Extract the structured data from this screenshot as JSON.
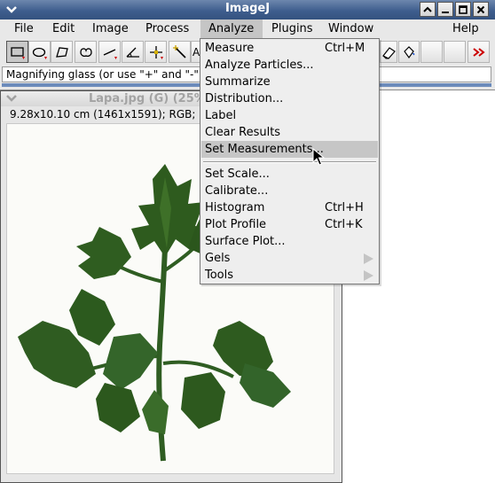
{
  "app": {
    "title": "ImageJ"
  },
  "window_buttons": [
    {
      "name": "window-menu-button",
      "glyph": "chevron-down-icon"
    },
    {
      "name": "collapse-button",
      "glyph": "chevron-up-icon"
    },
    {
      "name": "minimize-button",
      "glyph": "minimize-icon"
    },
    {
      "name": "maximize-button",
      "glyph": "maximize-icon"
    },
    {
      "name": "close-button",
      "glyph": "close-icon"
    }
  ],
  "menubar": {
    "items": [
      {
        "label": "File"
      },
      {
        "label": "Edit"
      },
      {
        "label": "Image"
      },
      {
        "label": "Process"
      },
      {
        "label": "Analyze",
        "active": true
      },
      {
        "label": "Plugins"
      },
      {
        "label": "Window"
      },
      {
        "label": "Help"
      }
    ]
  },
  "toolbar": {
    "tools": [
      "rectangle-selection-icon",
      "oval-selection-icon",
      "polygon-selection-icon",
      "freehand-selection-icon",
      "line-selection-icon",
      "angle-tool-icon",
      "point-tool-icon",
      "wand-tool-icon",
      "text-tool-icon",
      "magnifying-glass-icon",
      "scroll-tool-icon",
      "color-picker-icon",
      "dropper-icon",
      "eraser-icon",
      "paint-bucket-icon",
      "blank-tool-icon",
      "blank-tool-icon",
      "more-tools-icon"
    ],
    "selected_index": 0
  },
  "status": {
    "text": "Magnifying glass (or use \"+\" and \"-\""
  },
  "image_window": {
    "title": "Lapa.jpg (G) (25%)",
    "info": "9.28x10.10 cm (1461x1591); RGB;"
  },
  "analyze_menu": {
    "items": [
      {
        "label": "Measure",
        "accel": "Ctrl+M"
      },
      {
        "label": "Analyze Particles...",
        "accel": ""
      },
      {
        "label": "Summarize",
        "accel": ""
      },
      {
        "label": "Distribution...",
        "accel": ""
      },
      {
        "label": "Label",
        "accel": ""
      },
      {
        "label": "Clear Results",
        "accel": ""
      },
      {
        "label": "Set Measurements...",
        "accel": "",
        "hover": true
      },
      {
        "separator": true
      },
      {
        "label": "Set Scale...",
        "accel": ""
      },
      {
        "label": "Calibrate...",
        "accel": ""
      },
      {
        "label": "Histogram",
        "accel": "Ctrl+H"
      },
      {
        "label": "Plot Profile",
        "accel": "Ctrl+K"
      },
      {
        "label": "Surface Plot...",
        "accel": ""
      },
      {
        "label": "Gels",
        "accel": "",
        "submenu": true
      },
      {
        "label": "Tools",
        "accel": "",
        "submenu": true
      }
    ]
  },
  "colors": {
    "title_bar": "#3f5e8e",
    "menu_highlight": "#c6c6c6",
    "leaf_dark": "#2f5a1f",
    "leaf_light": "#4a7a2e"
  }
}
